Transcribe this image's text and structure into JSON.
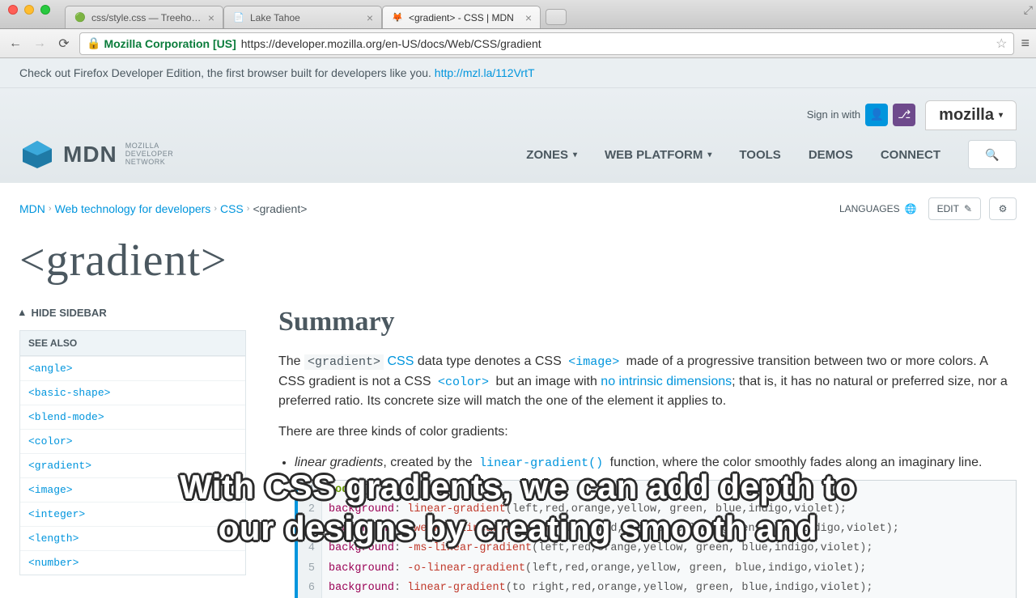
{
  "browser": {
    "tabs": [
      {
        "title": "css/style.css — Treehouse",
        "active": false
      },
      {
        "title": "Lake Tahoe",
        "active": false
      },
      {
        "title": "<gradient> - CSS | MDN",
        "active": true
      }
    ],
    "url_identity": "Mozilla Corporation [US]",
    "url": "https://developer.mozilla.org/en-US/docs/Web/CSS/gradient"
  },
  "promo": {
    "text_prefix": "Check out Firefox Developer Edition, the first browser built for developers like you. ",
    "link": "http://mzl.la/112VrtT"
  },
  "header": {
    "logo_text": "MDN",
    "logo_sub1": "MOZILLA",
    "logo_sub2": "DEVELOPER",
    "logo_sub3": "NETWORK",
    "signin_label": "Sign in with",
    "mozilla_label": "mozilla",
    "nav": {
      "zones": "ZONES",
      "web_platform": "WEB PLATFORM",
      "tools": "TOOLS",
      "demos": "DEMOS",
      "connect": "CONNECT"
    }
  },
  "breadcrumb": {
    "items": [
      "MDN",
      "Web technology for developers",
      "CSS",
      "<gradient>"
    ]
  },
  "page_actions": {
    "languages": "LANGUAGES",
    "edit": "EDIT"
  },
  "title": "<gradient>",
  "sidebar": {
    "hide": "HIDE SIDEBAR",
    "see_also": "SEE ALSO",
    "items": [
      "<angle>",
      "<basic-shape>",
      "<blend-mode>",
      "<color>",
      "<gradient>",
      "<image>",
      "<integer>",
      "<length>",
      "<number>"
    ]
  },
  "content": {
    "summary_heading": "Summary",
    "p1_a": "The ",
    "p1_code1": "<gradient>",
    "p1_b": " ",
    "p1_link_css": "CSS",
    "p1_c": " data type denotes a CSS ",
    "p1_code2": "<image>",
    "p1_d": " made of a progressive transition between two or more colors. A CSS gradient is not a CSS ",
    "p1_code3": "<color>",
    "p1_e": " but an image with ",
    "p1_link_dim": "no intrinsic dimensions",
    "p1_f": "; that is, it has no natural or preferred size, nor a preferred ratio. Its concrete size will match the one of the element it applies to.",
    "p2": "There are three kinds of color gradients:",
    "li1_a": "linear gradients",
    "li1_b": ", created by the ",
    "li1_func": "linear-gradient()",
    "li1_c": " function, where the color smoothly fades along an imaginary line.",
    "code": {
      "l1": "body {",
      "l2_prop": "background",
      "l2_func": "linear-gradient",
      "l2_args": "(left,red,orange,yellow, green, blue,indigo,violet)",
      "l3_prop": "background",
      "l3_func": "-webkit-linear-gradient",
      "l3_args": "(left,red,orange,yellow, green, blue,indigo,violet)",
      "l4_prop": "background",
      "l4_func": "-ms-linear-gradient",
      "l4_args": "(left,red,orange,yellow, green, blue,indigo,violet)",
      "l5_prop": "background",
      "l5_func": "-o-linear-gradient",
      "l5_args": "(left,red,orange,yellow, green, blue,indigo,violet)",
      "l6_prop": "background",
      "l6_func": "linear-gradient",
      "l6_args": "(to right,red,orange,yellow, green, blue,indigo,violet)"
    }
  },
  "caption": {
    "line1": "With CSS gradients, we can add depth to",
    "line2": "our designs by creating smooth and"
  }
}
